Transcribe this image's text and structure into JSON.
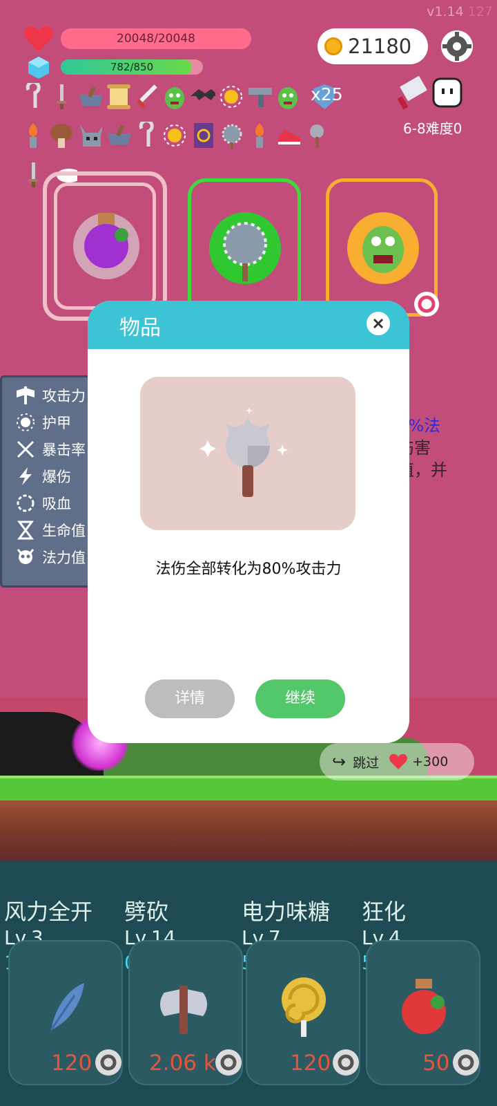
{
  "version": "v1.14",
  "fps": "127",
  "hp": {
    "text": "20048/20048",
    "fraction": 1.0
  },
  "mana": {
    "text": "782/850",
    "fraction": 0.92
  },
  "coins": "21180",
  "stack_count": "x25",
  "difficulty": "6-8难度0",
  "colors": {
    "bg": "#c24d7a",
    "modal_header": "#3dc3d6",
    "continue": "#52c86a",
    "details": "#bdbdbd",
    "hp": "#ff6b8a",
    "mana": "#2fc898",
    "card1": "#f0c0c8",
    "card2": "#3cdc3c",
    "card3": "#f8ae30",
    "cost": "#e7543e",
    "count": "#3fd8f0"
  },
  "icons": [
    "hook-icon",
    "dagger-icon",
    "mortar-icon",
    "scroll-icon",
    "sword-icon",
    "green-monster-icon",
    "bat-icon",
    "sun-icon",
    "gun-icon",
    "green-monster-icon",
    "shield-icon",
    "torch-icon",
    "mushroom-icon",
    "horned-helmet-icon",
    "mortar-icon",
    "hook-icon",
    "sun-icon",
    "spellbook-icon",
    "spiked-ball-icon",
    "torch-icon",
    "sneaker-icon",
    "spiked-mace-icon",
    "dagger-icon",
    "ghost-icon"
  ],
  "stats": [
    {
      "icon": "axe-icon",
      "label": "攻击力"
    },
    {
      "icon": "sun-icon",
      "label": "护甲"
    },
    {
      "icon": "crossed-swords-icon",
      "label": "暴击率"
    },
    {
      "icon": "lightning-icon",
      "label": "爆伤"
    },
    {
      "icon": "circle-dots-icon",
      "label": "吸血"
    },
    {
      "icon": "hourglass-icon",
      "label": "生命值"
    },
    {
      "icon": "skull-icon",
      "label": "法力值"
    }
  ],
  "bg_desc": {
    "line1": "0%法",
    "line2": "伤害",
    "line3": "值，并"
  },
  "modal": {
    "title": "物品",
    "description": "法伤全部转化为80%攻击力",
    "details": "详情",
    "continue": "继续"
  },
  "skip": {
    "label": "跳过",
    "reward": "+300"
  },
  "skills": [
    {
      "name": "风力全开",
      "level": "Lv.3",
      "count": "15",
      "cost": "120",
      "icon": "feather-icon"
    },
    {
      "name": "劈砍",
      "level": "Lv.14",
      "count": "0",
      "cost": "2.06 k",
      "icon": "battle-axe-icon"
    },
    {
      "name": "电力味糖",
      "level": "Lv.7",
      "count": "5",
      "cost": "120",
      "icon": "lollipop-icon"
    },
    {
      "name": "狂化",
      "level": "Lv.4",
      "count": "5",
      "cost": "50",
      "icon": "red-potion-icon"
    }
  ]
}
